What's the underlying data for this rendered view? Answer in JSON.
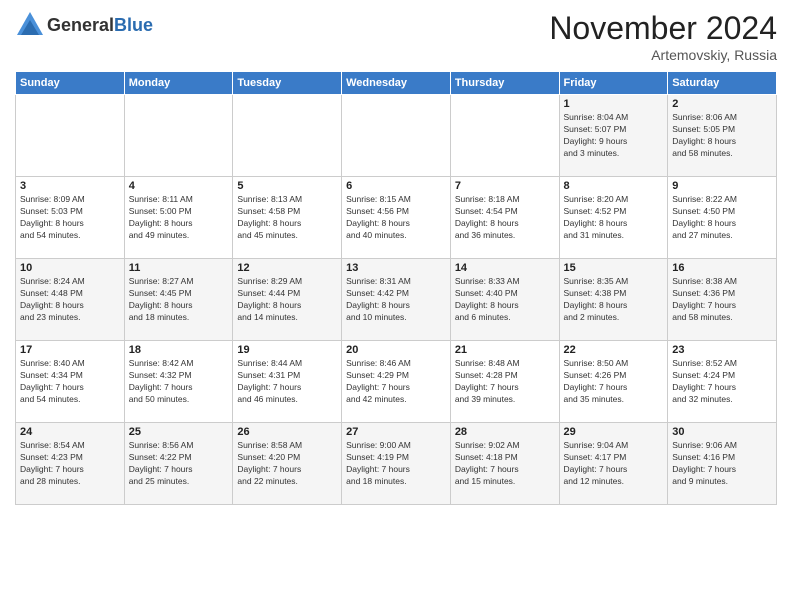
{
  "header": {
    "logo_general": "General",
    "logo_blue": "Blue",
    "month_title": "November 2024",
    "subtitle": "Artemovskiy, Russia"
  },
  "days_of_week": [
    "Sunday",
    "Monday",
    "Tuesday",
    "Wednesday",
    "Thursday",
    "Friday",
    "Saturday"
  ],
  "weeks": [
    [
      {
        "day": "",
        "info": ""
      },
      {
        "day": "",
        "info": ""
      },
      {
        "day": "",
        "info": ""
      },
      {
        "day": "",
        "info": ""
      },
      {
        "day": "",
        "info": ""
      },
      {
        "day": "1",
        "info": "Sunrise: 8:04 AM\nSunset: 5:07 PM\nDaylight: 9 hours\nand 3 minutes."
      },
      {
        "day": "2",
        "info": "Sunrise: 8:06 AM\nSunset: 5:05 PM\nDaylight: 8 hours\nand 58 minutes."
      }
    ],
    [
      {
        "day": "3",
        "info": "Sunrise: 8:09 AM\nSunset: 5:03 PM\nDaylight: 8 hours\nand 54 minutes."
      },
      {
        "day": "4",
        "info": "Sunrise: 8:11 AM\nSunset: 5:00 PM\nDaylight: 8 hours\nand 49 minutes."
      },
      {
        "day": "5",
        "info": "Sunrise: 8:13 AM\nSunset: 4:58 PM\nDaylight: 8 hours\nand 45 minutes."
      },
      {
        "day": "6",
        "info": "Sunrise: 8:15 AM\nSunset: 4:56 PM\nDaylight: 8 hours\nand 40 minutes."
      },
      {
        "day": "7",
        "info": "Sunrise: 8:18 AM\nSunset: 4:54 PM\nDaylight: 8 hours\nand 36 minutes."
      },
      {
        "day": "8",
        "info": "Sunrise: 8:20 AM\nSunset: 4:52 PM\nDaylight: 8 hours\nand 31 minutes."
      },
      {
        "day": "9",
        "info": "Sunrise: 8:22 AM\nSunset: 4:50 PM\nDaylight: 8 hours\nand 27 minutes."
      }
    ],
    [
      {
        "day": "10",
        "info": "Sunrise: 8:24 AM\nSunset: 4:48 PM\nDaylight: 8 hours\nand 23 minutes."
      },
      {
        "day": "11",
        "info": "Sunrise: 8:27 AM\nSunset: 4:45 PM\nDaylight: 8 hours\nand 18 minutes."
      },
      {
        "day": "12",
        "info": "Sunrise: 8:29 AM\nSunset: 4:44 PM\nDaylight: 8 hours\nand 14 minutes."
      },
      {
        "day": "13",
        "info": "Sunrise: 8:31 AM\nSunset: 4:42 PM\nDaylight: 8 hours\nand 10 minutes."
      },
      {
        "day": "14",
        "info": "Sunrise: 8:33 AM\nSunset: 4:40 PM\nDaylight: 8 hours\nand 6 minutes."
      },
      {
        "day": "15",
        "info": "Sunrise: 8:35 AM\nSunset: 4:38 PM\nDaylight: 8 hours\nand 2 minutes."
      },
      {
        "day": "16",
        "info": "Sunrise: 8:38 AM\nSunset: 4:36 PM\nDaylight: 7 hours\nand 58 minutes."
      }
    ],
    [
      {
        "day": "17",
        "info": "Sunrise: 8:40 AM\nSunset: 4:34 PM\nDaylight: 7 hours\nand 54 minutes."
      },
      {
        "day": "18",
        "info": "Sunrise: 8:42 AM\nSunset: 4:32 PM\nDaylight: 7 hours\nand 50 minutes."
      },
      {
        "day": "19",
        "info": "Sunrise: 8:44 AM\nSunset: 4:31 PM\nDaylight: 7 hours\nand 46 minutes."
      },
      {
        "day": "20",
        "info": "Sunrise: 8:46 AM\nSunset: 4:29 PM\nDaylight: 7 hours\nand 42 minutes."
      },
      {
        "day": "21",
        "info": "Sunrise: 8:48 AM\nSunset: 4:28 PM\nDaylight: 7 hours\nand 39 minutes."
      },
      {
        "day": "22",
        "info": "Sunrise: 8:50 AM\nSunset: 4:26 PM\nDaylight: 7 hours\nand 35 minutes."
      },
      {
        "day": "23",
        "info": "Sunrise: 8:52 AM\nSunset: 4:24 PM\nDaylight: 7 hours\nand 32 minutes."
      }
    ],
    [
      {
        "day": "24",
        "info": "Sunrise: 8:54 AM\nSunset: 4:23 PM\nDaylight: 7 hours\nand 28 minutes."
      },
      {
        "day": "25",
        "info": "Sunrise: 8:56 AM\nSunset: 4:22 PM\nDaylight: 7 hours\nand 25 minutes."
      },
      {
        "day": "26",
        "info": "Sunrise: 8:58 AM\nSunset: 4:20 PM\nDaylight: 7 hours\nand 22 minutes."
      },
      {
        "day": "27",
        "info": "Sunrise: 9:00 AM\nSunset: 4:19 PM\nDaylight: 7 hours\nand 18 minutes."
      },
      {
        "day": "28",
        "info": "Sunrise: 9:02 AM\nSunset: 4:18 PM\nDaylight: 7 hours\nand 15 minutes."
      },
      {
        "day": "29",
        "info": "Sunrise: 9:04 AM\nSunset: 4:17 PM\nDaylight: 7 hours\nand 12 minutes."
      },
      {
        "day": "30",
        "info": "Sunrise: 9:06 AM\nSunset: 4:16 PM\nDaylight: 7 hours\nand 9 minutes."
      }
    ]
  ]
}
